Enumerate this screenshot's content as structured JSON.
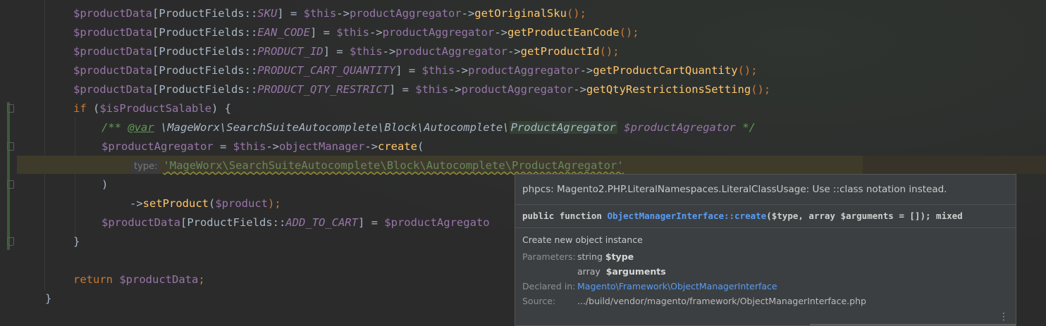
{
  "code": {
    "l1": {
      "var": "$productData",
      "br": "[ProductFields::",
      "const": "SKU",
      "mid": "] = ",
      "this": "$this",
      "arrow1": "->",
      "prop": "productAggregator",
      "arrow2": "->",
      "fn": "getOriginalSku",
      "tail": "();"
    },
    "l2": {
      "var": "$productData",
      "br": "[ProductFields::",
      "const": "EAN_CODE",
      "mid": "] = ",
      "this": "$this",
      "arrow1": "->",
      "prop": "productAggregator",
      "arrow2": "->",
      "fn": "getProductEanCode",
      "tail": "();"
    },
    "l3": {
      "var": "$productData",
      "br": "[ProductFields::",
      "const": "PRODUCT_ID",
      "mid": "] = ",
      "this": "$this",
      "arrow1": "->",
      "prop": "productAggregator",
      "arrow2": "->",
      "fn": "getProductId",
      "tail": "();"
    },
    "l4": {
      "var": "$productData",
      "br": "[ProductFields::",
      "const": "PRODUCT_CART_QUANTITY",
      "mid": "] = ",
      "this": "$this",
      "arrow1": "->",
      "prop": "productAggregator",
      "arrow2": "->",
      "fn": "getProductCartQuantity",
      "tail": "();"
    },
    "l5": {
      "var": "$productData",
      "br": "[ProductFields::",
      "const": "PRODUCT_QTY_RESTRICT",
      "mid": "] = ",
      "this": "$this",
      "arrow1": "->",
      "prop": "productAggregator",
      "arrow2": "->",
      "fn": "getQtyRestrictionsSetting",
      "tail": "();"
    },
    "l6": {
      "kw": "if",
      "open": " (",
      "var": "$isProductSalable",
      "close": ") {"
    },
    "l7": {
      "open": "/** ",
      "tag": "@var",
      "path": " \\MageWorx\\SearchSuiteAutocomplete\\Block\\Autocomplete\\",
      "cls": "ProductAgregator",
      "sp": " ",
      "var": "$productAgregator",
      "close": " */"
    },
    "l8": {
      "var": "$productAgregator",
      "eq": " = ",
      "this": "$this",
      "arrow1": "->",
      "prop": "objectManager",
      "arrow2": "->",
      "fn": "create",
      "open": "("
    },
    "l9": {
      "hint": "type:",
      "str": "'MageWorx\\SearchSuiteAutocomplete\\Block\\Autocomplete\\ProductAgregator'"
    },
    "l10": {
      "text": ")"
    },
    "l11": {
      "arrow": "->",
      "fn": "setProduct",
      "open": "(",
      "var": "$product",
      "close": ");"
    },
    "l12": {
      "var": "$productData",
      "br": "[ProductFields::",
      "const": "ADD_TO_CART",
      "mid": "] = ",
      "var2": "$productAgregato"
    },
    "l13": {
      "text": "}"
    },
    "l14": {
      "kw": "return",
      "sp": " ",
      "var": "$productData",
      "semi": ";"
    },
    "l15": {
      "text": "}"
    }
  },
  "tooltip": {
    "inspection": "phpcs: Magento2.PHP.LiteralNamespaces.LiteralClassUsage: Use ::class notation instead.",
    "signature": {
      "kw1": "public",
      "kw2": "function",
      "name": "ObjectManagerInterface::create",
      "params": "($type, array $arguments = []); mixed"
    },
    "description": "Create new object instance",
    "parameters_label": "Parameters:",
    "params": [
      {
        "type": "string",
        "name": "$type"
      },
      {
        "type": "array",
        "name": "$arguments"
      }
    ],
    "declared_label": "Declared in:",
    "declared_in": "Magento\\Framework\\ObjectManagerInterface",
    "source_label": "Source:",
    "source": ".../build/vendor/magento/framework/ObjectManagerInterface.php",
    "more_glyph": "⋮"
  },
  "colors": {
    "background": "#2b2b2b",
    "keyword": "#cc7832",
    "variable": "#9876aa",
    "function": "#ffc66d",
    "string": "#6a8759",
    "link": "#589df6"
  }
}
